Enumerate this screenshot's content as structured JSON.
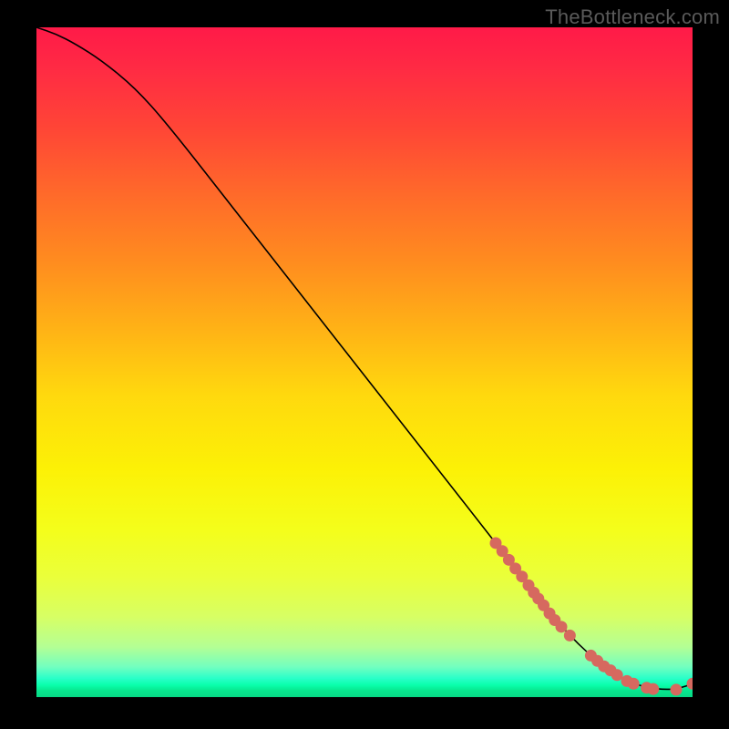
{
  "watermark": "TheBottleneck.com",
  "colors": {
    "background": "#000000",
    "curve_stroke": "#000000",
    "point_fill": "#d6695f",
    "gradient_top": "#ff1a48",
    "gradient_mid": "#ffe000",
    "gradient_bottom": "#07d885"
  },
  "chart_data": {
    "type": "line",
    "title": "",
    "xlabel": "",
    "ylabel": "",
    "xlim": [
      0,
      100
    ],
    "ylim": [
      0,
      100
    ],
    "grid": false,
    "curve": {
      "x": [
        0,
        3,
        6,
        10,
        15,
        20,
        30,
        40,
        50,
        60,
        70,
        75,
        78,
        81,
        84,
        87,
        90,
        93,
        96,
        98,
        100
      ],
      "y": [
        100,
        99,
        97.5,
        95,
        91,
        85.5,
        73,
        60.5,
        48,
        35.5,
        23,
        16.7,
        12.9,
        9.5,
        6.6,
        4.2,
        2.4,
        1.4,
        1.1,
        1.3,
        2.0
      ]
    },
    "series": [
      {
        "name": "points",
        "type": "scatter",
        "x": [
          70,
          71,
          72,
          73,
          74,
          75,
          75.8,
          76.5,
          77.3,
          78.2,
          79,
          80,
          81.3,
          84.5,
          85.5,
          86.5,
          87.5,
          88.5,
          90,
          91,
          93,
          94,
          97.5,
          100
        ],
        "y": [
          23,
          21.8,
          20.5,
          19.2,
          18,
          16.7,
          15.6,
          14.7,
          13.7,
          12.5,
          11.5,
          10.5,
          9.2,
          6.2,
          5.4,
          4.6,
          4.0,
          3.3,
          2.4,
          2.0,
          1.4,
          1.2,
          1.1,
          2.0
        ]
      }
    ]
  }
}
